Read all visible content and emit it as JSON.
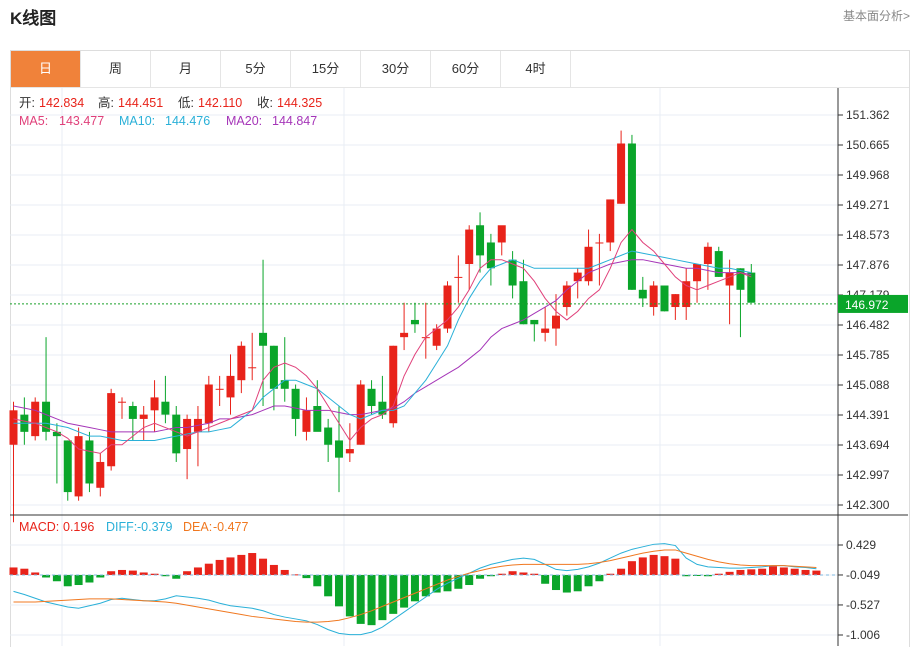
{
  "header": {
    "title": "K线图",
    "link": "基本面分析>"
  },
  "tabs": [
    {
      "label": "日",
      "active": true
    },
    {
      "label": "周",
      "active": false
    },
    {
      "label": "月",
      "active": false
    },
    {
      "label": "5分",
      "active": false
    },
    {
      "label": "15分",
      "active": false
    },
    {
      "label": "30分",
      "active": false
    },
    {
      "label": "60分",
      "active": false
    },
    {
      "label": "4时",
      "active": false
    }
  ],
  "ohlc_info": {
    "open_label": "开:",
    "open": "142.834",
    "high_label": "高:",
    "high": "144.451",
    "low_label": "低:",
    "low": "142.110",
    "close_label": "收:",
    "close": "144.325"
  },
  "ma_info": {
    "ma5_label": "MA5:",
    "ma5": "143.477",
    "ma10_label": "MA10:",
    "ma10": "144.476",
    "ma20_label": "MA20:",
    "ma20": "144.847"
  },
  "macd_info": {
    "macd_label": "MACD:",
    "macd": "0.196",
    "diff_label": "DIFF:",
    "diff": "-0.379",
    "dea_label": "DEA:",
    "dea": "-0.477"
  },
  "colors": {
    "up": "#e8231a",
    "down": "#0aa52a",
    "ma5": "#e0407a",
    "ma10": "#2ab0d8",
    "ma20": "#a535b8",
    "dea": "#f07820",
    "grid": "#e8eef4"
  },
  "chart_data": [
    {
      "type": "candlestick",
      "ylim": [
        142.1,
        151.6
      ],
      "y_ticks": [
        "151.362",
        "150.665",
        "149.968",
        "149.271",
        "148.573",
        "147.876",
        "147.179",
        "146.482",
        "145.785",
        "145.088",
        "144.391",
        "143.694",
        "142.997",
        "142.300"
      ],
      "last_price": "146.972",
      "candles": [
        [
          143.7,
          144.7,
          141.9,
          144.5
        ],
        [
          144.4,
          144.8,
          143.7,
          144.0
        ],
        [
          143.9,
          144.8,
          143.8,
          144.7
        ],
        [
          144.7,
          146.2,
          143.8,
          144.0
        ],
        [
          144.0,
          144.2,
          142.8,
          143.9
        ],
        [
          143.8,
          143.8,
          142.4,
          142.6
        ],
        [
          142.5,
          144.1,
          142.4,
          143.9
        ],
        [
          143.8,
          144.0,
          142.6,
          142.8
        ],
        [
          142.7,
          143.5,
          142.5,
          143.3
        ],
        [
          143.2,
          145.0,
          143.1,
          144.9
        ],
        [
          144.7,
          144.8,
          144.3,
          144.7
        ],
        [
          144.6,
          144.7,
          143.8,
          144.3
        ],
        [
          144.3,
          144.6,
          143.8,
          144.4
        ],
        [
          144.5,
          145.2,
          144.0,
          144.8
        ],
        [
          144.7,
          145.3,
          144.2,
          144.4
        ],
        [
          144.4,
          144.6,
          143.3,
          143.5
        ],
        [
          143.6,
          144.4,
          142.9,
          144.3
        ],
        [
          144.0,
          144.6,
          143.2,
          144.3
        ],
        [
          144.2,
          145.3,
          144.0,
          145.1
        ],
        [
          145.0,
          145.3,
          144.6,
          145.0
        ],
        [
          144.8,
          145.8,
          144.4,
          145.3
        ],
        [
          145.2,
          146.1,
          144.9,
          146.0
        ],
        [
          145.5,
          146.3,
          145.2,
          145.5
        ],
        [
          146.3,
          148.0,
          144.6,
          146.0
        ],
        [
          146.0,
          146.0,
          144.5,
          145.0
        ],
        [
          145.2,
          146.2,
          144.7,
          145.0
        ],
        [
          145.0,
          145.1,
          143.9,
          144.3
        ],
        [
          144.0,
          144.8,
          143.8,
          144.5
        ],
        [
          144.6,
          145.2,
          144.1,
          144.0
        ],
        [
          144.1,
          144.3,
          143.3,
          143.7
        ],
        [
          143.8,
          144.6,
          142.6,
          143.4
        ],
        [
          143.5,
          144.2,
          143.3,
          143.6
        ],
        [
          143.7,
          145.2,
          143.7,
          145.1
        ],
        [
          145.0,
          145.2,
          144.4,
          144.6
        ],
        [
          144.7,
          145.3,
          144.3,
          144.4
        ],
        [
          144.2,
          146.0,
          144.1,
          146.0
        ],
        [
          146.2,
          147.0,
          145.9,
          146.3
        ],
        [
          146.6,
          147.0,
          146.3,
          146.5
        ],
        [
          146.2,
          147.0,
          145.7,
          146.2
        ],
        [
          146.0,
          146.5,
          145.9,
          146.4
        ],
        [
          146.4,
          147.5,
          146.3,
          147.4
        ],
        [
          147.6,
          148.1,
          147.0,
          147.6
        ],
        [
          147.9,
          148.8,
          147.3,
          148.7
        ],
        [
          148.8,
          149.1,
          147.7,
          148.1
        ],
        [
          148.4,
          148.6,
          147.4,
          147.8
        ],
        [
          148.4,
          148.6,
          148.1,
          148.8
        ],
        [
          148.0,
          148.2,
          147.1,
          147.4
        ],
        [
          147.5,
          148.0,
          146.5,
          146.5
        ],
        [
          146.6,
          146.6,
          146.1,
          146.5
        ],
        [
          146.3,
          146.9,
          146.1,
          146.4
        ],
        [
          146.4,
          147.2,
          146.0,
          146.7
        ],
        [
          146.9,
          147.5,
          146.7,
          147.4
        ],
        [
          147.5,
          147.8,
          147.1,
          147.7
        ],
        [
          147.5,
          148.7,
          147.4,
          148.3
        ],
        [
          148.4,
          148.6,
          147.4,
          148.4
        ],
        [
          148.4,
          149.4,
          148.2,
          149.4
        ],
        [
          149.3,
          151.0,
          149.3,
          150.7
        ],
        [
          150.7,
          150.9,
          147.3,
          147.3
        ],
        [
          147.3,
          147.6,
          146.9,
          147.1
        ],
        [
          146.9,
          147.5,
          146.7,
          147.4
        ],
        [
          147.4,
          147.4,
          146.8,
          146.8
        ],
        [
          146.9,
          147.2,
          146.6,
          147.2
        ],
        [
          146.9,
          147.8,
          146.6,
          147.5
        ],
        [
          147.5,
          147.8,
          147.0,
          147.9
        ],
        [
          147.9,
          148.4,
          147.3,
          148.3
        ],
        [
          148.2,
          148.3,
          147.6,
          147.6
        ],
        [
          147.4,
          148.0,
          146.5,
          147.7
        ],
        [
          147.8,
          147.8,
          146.2,
          147.3
        ],
        [
          147.7,
          147.9,
          147.0,
          147.0
        ]
      ],
      "ma5": [
        144.3,
        144.25,
        144.2,
        144.1,
        144.0,
        143.85,
        143.6,
        143.55,
        143.5,
        143.7,
        143.7,
        143.9,
        144.1,
        144.2,
        144.1,
        144.0,
        143.9,
        144.0,
        144.1,
        144.2,
        144.3,
        144.4,
        144.5,
        145.2,
        145.5,
        145.6,
        145.5,
        145.3,
        145.0,
        144.6,
        144.2,
        143.8,
        144.1,
        144.3,
        144.4,
        144.6,
        145.3,
        145.8,
        146.2,
        146.4,
        146.6,
        146.9,
        147.3,
        147.8,
        148.0,
        148.0,
        147.9,
        147.8,
        147.5,
        147.1,
        146.8,
        146.6,
        146.8,
        147.1,
        147.3,
        147.8,
        148.4,
        148.7,
        148.4,
        148.2,
        147.9,
        147.6,
        147.4,
        147.3,
        147.4,
        147.5,
        147.6,
        147.7,
        147.6
      ],
      "ma10": [
        144.2,
        144.2,
        144.2,
        144.2,
        144.15,
        144.1,
        144.0,
        143.9,
        143.9,
        143.85,
        143.8,
        143.8,
        143.8,
        143.8,
        143.85,
        143.9,
        143.95,
        144.0,
        144.0,
        144.05,
        144.1,
        144.3,
        144.5,
        144.8,
        145.0,
        145.2,
        145.2,
        145.1,
        145.0,
        144.8,
        144.6,
        144.4,
        144.3,
        144.4,
        144.5,
        144.5,
        144.6,
        144.9,
        145.2,
        145.6,
        146.0,
        146.6,
        147.1,
        147.5,
        147.8,
        147.9,
        148.0,
        147.9,
        147.8,
        147.8,
        147.8,
        147.8,
        147.8,
        147.8,
        147.9,
        148.0,
        148.1,
        148.2,
        148.15,
        148.1,
        148.05,
        148.0,
        147.95,
        147.9,
        147.85,
        147.8,
        147.8,
        147.75,
        147.7
      ],
      "ma20": [
        144.6,
        144.55,
        144.5,
        144.4,
        144.3,
        144.2,
        144.15,
        144.1,
        144.05,
        144.0,
        144.0,
        144.0,
        144.0,
        144.0,
        144.05,
        144.1,
        144.1,
        144.15,
        144.2,
        144.3,
        144.3,
        144.35,
        144.4,
        144.5,
        144.6,
        144.6,
        144.55,
        144.5,
        144.5,
        144.5,
        144.45,
        144.4,
        144.4,
        144.45,
        144.5,
        144.55,
        144.7,
        144.9,
        145.05,
        145.2,
        145.35,
        145.5,
        145.7,
        145.9,
        146.2,
        146.4,
        146.5,
        146.6,
        146.75,
        146.9,
        147.05,
        147.3,
        147.5,
        147.7,
        147.8,
        147.9,
        147.95,
        148.0,
        148.0,
        147.95,
        147.9,
        147.85,
        147.8,
        147.8,
        147.75,
        147.7,
        147.7,
        147.7,
        147.65
      ]
    },
    {
      "type": "bar",
      "name": "MACD",
      "y_ticks": [
        "0.429",
        "-0.049",
        "-0.527",
        "-1.006"
      ],
      "ylim": [
        -1.06,
        0.69
      ],
      "macd": [
        0.12,
        0.1,
        0.04,
        -0.04,
        -0.1,
        -0.18,
        -0.16,
        -0.12,
        -0.04,
        0.06,
        0.08,
        0.07,
        0.04,
        0.02,
        -0.02,
        -0.06,
        0.06,
        0.12,
        0.18,
        0.24,
        0.28,
        0.32,
        0.35,
        0.26,
        0.16,
        0.08,
        0.01,
        -0.05,
        -0.18,
        -0.34,
        -0.5,
        -0.66,
        -0.78,
        -0.8,
        -0.72,
        -0.62,
        -0.52,
        -0.42,
        -0.34,
        -0.28,
        -0.26,
        -0.22,
        -0.16,
        -0.06,
        -0.02,
        0.02,
        0.06,
        0.04,
        0.02,
        -0.14,
        -0.24,
        -0.28,
        -0.26,
        -0.18,
        -0.1,
        0.02,
        0.1,
        0.22,
        0.28,
        0.32,
        0.3,
        0.26,
        -0.02,
        -0.01,
        -0.02,
        0.02,
        0.05,
        0.08,
        0.09,
        0.1,
        0.14,
        0.12,
        0.1,
        0.08,
        0.07
      ],
      "diff": [
        -0.31,
        -0.36,
        -0.42,
        -0.48,
        -0.52,
        -0.56,
        -0.58,
        -0.54,
        -0.5,
        -0.44,
        -0.42,
        -0.44,
        -0.46,
        -0.46,
        -0.43,
        -0.38,
        -0.4,
        -0.42,
        -0.45,
        -0.5,
        -0.54,
        -0.56,
        -0.58,
        -0.62,
        -0.68,
        -0.72,
        -0.75,
        -0.78,
        -0.84,
        -0.92,
        -0.98,
        -1.0,
        -1.0,
        -0.96,
        -0.88,
        -0.76,
        -0.64,
        -0.52,
        -0.4,
        -0.28,
        -0.18,
        -0.1,
        -0.02,
        0.06,
        0.12,
        0.16,
        0.2,
        0.22,
        0.2,
        0.12,
        0.04,
        0.02,
        0.04,
        0.08,
        0.14,
        0.22,
        0.3,
        0.36,
        0.4,
        0.44,
        0.45,
        0.42,
        0.22,
        0.12,
        0.08,
        0.07,
        0.06,
        0.06,
        0.07,
        0.08,
        0.1,
        0.1,
        0.08,
        0.07,
        0.05
      ],
      "dea": [
        -0.48,
        -0.48,
        -0.48,
        -0.47,
        -0.46,
        -0.45,
        -0.44,
        -0.43,
        -0.43,
        -0.43,
        -0.44,
        -0.45,
        -0.46,
        -0.47,
        -0.48,
        -0.5,
        -0.53,
        -0.56,
        -0.59,
        -0.62,
        -0.65,
        -0.68,
        -0.71,
        -0.73,
        -0.75,
        -0.77,
        -0.79,
        -0.8,
        -0.8,
        -0.79,
        -0.77,
        -0.73,
        -0.68,
        -0.62,
        -0.55,
        -0.48,
        -0.41,
        -0.34,
        -0.27,
        -0.2,
        -0.13,
        -0.07,
        -0.02,
        0.02,
        0.06,
        0.09,
        0.11,
        0.12,
        0.12,
        0.12,
        0.12,
        0.12,
        0.12,
        0.13,
        0.15,
        0.18,
        0.22,
        0.26,
        0.3,
        0.33,
        0.35,
        0.35,
        0.3,
        0.25,
        0.2,
        0.16,
        0.13,
        0.11,
        0.1,
        0.1,
        0.1,
        0.1,
        0.09,
        0.08,
        0.07
      ]
    }
  ]
}
